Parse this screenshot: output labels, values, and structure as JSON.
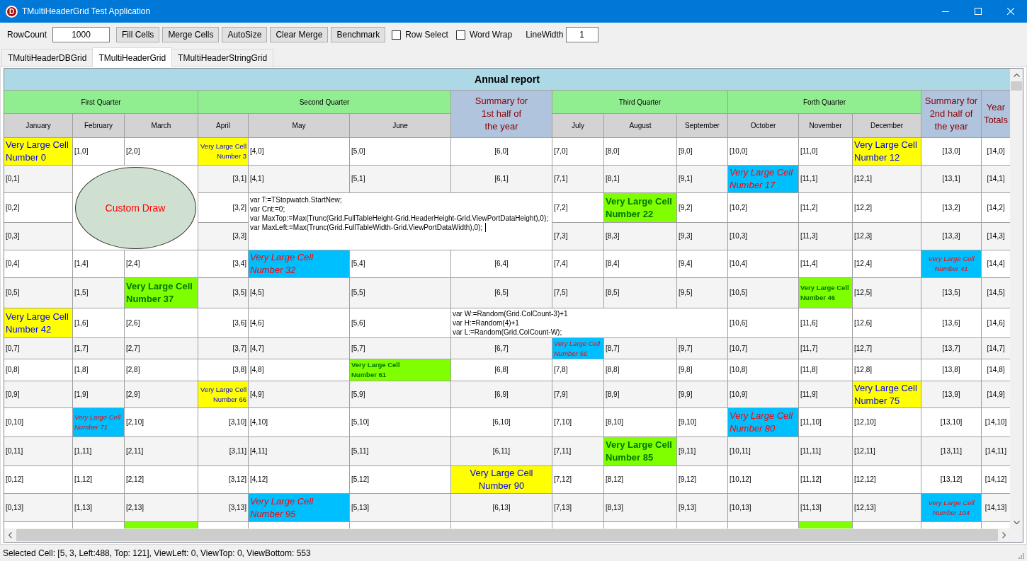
{
  "window": {
    "icon_letter": "D",
    "title": "TMultiHeaderGrid Test Application"
  },
  "toolbar": {
    "row_count": {
      "label": "RowCount",
      "value": "1000"
    },
    "buttons": [
      "Fill Cells",
      "Merge Cells",
      "AutoSize",
      "Clear Merge",
      "Benchmark"
    ],
    "checkboxes": [
      {
        "label": "Row Select",
        "checked": false
      },
      {
        "label": "Word Wrap",
        "checked": false
      }
    ],
    "line_width": {
      "label": "LineWidth",
      "value": "1"
    }
  },
  "tabs": [
    {
      "label": "TMultiHeaderDBGrid",
      "selected": false
    },
    {
      "label": "TMultiHeaderGrid",
      "selected": true
    },
    {
      "label": "TMultiHeaderStringGrid",
      "selected": false
    }
  ],
  "grid": {
    "title": "Annual report",
    "groups": [
      {
        "kind": "quarter",
        "label": "First Quarter",
        "columns": [
          "January",
          "February",
          "March"
        ]
      },
      {
        "kind": "quarter",
        "label": "Second Quarter",
        "columns": [
          "April",
          "May",
          "June"
        ]
      },
      {
        "kind": "summary",
        "label": "Summary for\n1st half of\nthe year"
      },
      {
        "kind": "quarter",
        "label": "Third Quarter",
        "columns": [
          "July",
          "August",
          "September"
        ]
      },
      {
        "kind": "quarter",
        "label": "Forth Quarter",
        "columns": [
          "October",
          "November",
          "December"
        ]
      },
      {
        "kind": "summary",
        "label": "Summary for\n2nd half of\nthe year"
      },
      {
        "kind": "summary",
        "label": "Year\nTotals"
      }
    ],
    "rows": [
      [
        {
          "kind": "yellow",
          "large": true,
          "text": "Very Large Cell\nNumber 0"
        },
        {
          "kind": "plain",
          "text": "[1,0]"
        },
        {
          "kind": "plain",
          "text": "[2,0]"
        },
        {
          "kind": "yellow",
          "large": false,
          "text": "Very Large Cell\nNumber 3"
        },
        {
          "kind": "plain",
          "text": "[4,0]"
        },
        {
          "kind": "plain",
          "text": "[5,0]"
        },
        {
          "kind": "plain",
          "text": "[6,0]"
        },
        {
          "kind": "plain",
          "text": "[7,0]"
        },
        {
          "kind": "plain",
          "text": "[8,0]"
        },
        {
          "kind": "plain",
          "text": "[9,0]"
        },
        {
          "kind": "plain",
          "text": "[10,0]"
        },
        {
          "kind": "plain",
          "text": "[11,0]"
        },
        {
          "kind": "yellow",
          "large": true,
          "text": "Very Large Cell\nNumber 12"
        },
        {
          "kind": "plain",
          "text": "[13,0]"
        },
        {
          "kind": "plain",
          "text": "[14,0]"
        }
      ],
      [
        {
          "kind": "plain",
          "text": "[0,1]"
        },
        {
          "kind": "covered"
        },
        {
          "kind": "covered"
        },
        {
          "kind": "plain",
          "text": "[3,1]"
        },
        {
          "kind": "plain",
          "text": "[4,1]"
        },
        {
          "kind": "plain",
          "text": "[5,1]"
        },
        {
          "kind": "plain",
          "text": "[6,1]"
        },
        {
          "kind": "plain",
          "text": "[7,1]"
        },
        {
          "kind": "plain",
          "text": "[8,1]"
        },
        {
          "kind": "plain",
          "text": "[9,1]"
        },
        {
          "kind": "cyan",
          "large": true,
          "text": "Very Large Cell\nNumber 17"
        },
        {
          "kind": "plain",
          "text": "[11,1]"
        },
        {
          "kind": "plain",
          "text": "[12,1]"
        },
        {
          "kind": "plain",
          "text": "[13,1]"
        },
        {
          "kind": "plain",
          "text": "[14,1]"
        }
      ],
      [
        {
          "kind": "plain",
          "text": "[0,2]"
        },
        {
          "kind": "drawing",
          "text": "Custom Draw"
        },
        {
          "kind": "covered"
        },
        {
          "kind": "plain",
          "text": "[3,2]"
        },
        {
          "kind": "code",
          "editing": true,
          "text": "var T:=TStopwatch.StartNew;\nvar Cnt:=0;\nvar MaxTop:=Max(Trunc(Grid.FullTableHeight-Grid.HeaderHeight-Grid.ViewPortDataHeight),0);\nvar MaxLeft:=Max(Trunc(Grid.FullTableWidth-Grid.ViewPortDataWidth),0);"
        },
        {
          "kind": "covered"
        },
        {
          "kind": "covered"
        },
        {
          "kind": "plain",
          "text": "[7,2]"
        },
        {
          "kind": "green",
          "large": true,
          "text": "Very Large Cell\nNumber 22"
        },
        {
          "kind": "plain",
          "text": "[9,2]"
        },
        {
          "kind": "plain",
          "text": "[10,2]"
        },
        {
          "kind": "plain",
          "text": "[11,2]"
        },
        {
          "kind": "plain",
          "text": "[12,2]"
        },
        {
          "kind": "plain",
          "text": "[13,2]"
        },
        {
          "kind": "plain",
          "text": "[14,2]"
        }
      ],
      [
        {
          "kind": "plain",
          "text": "[0,3]"
        },
        {
          "kind": "covered"
        },
        {
          "kind": "covered"
        },
        {
          "kind": "plain",
          "text": "[3,3]"
        },
        {
          "kind": "covered"
        },
        {
          "kind": "covered"
        },
        {
          "kind": "covered"
        },
        {
          "kind": "plain",
          "text": "[7,3]"
        },
        {
          "kind": "plain",
          "text": "[8,3]"
        },
        {
          "kind": "plain",
          "text": "[9,3]"
        },
        {
          "kind": "plain",
          "text": "[10,3]"
        },
        {
          "kind": "plain",
          "text": "[11,3]"
        },
        {
          "kind": "plain",
          "text": "[12,3]"
        },
        {
          "kind": "plain",
          "text": "[13,3]"
        },
        {
          "kind": "plain",
          "text": "[14,3]"
        }
      ],
      [
        {
          "kind": "plain",
          "text": "[0,4]"
        },
        {
          "kind": "plain",
          "text": "[1,4]"
        },
        {
          "kind": "plain",
          "text": "[2,4]"
        },
        {
          "kind": "plain",
          "text": "[3,4]"
        },
        {
          "kind": "cyan",
          "large": true,
          "text": "Very Large Cell\nNumber 32"
        },
        {
          "kind": "plain",
          "text": "[5,4]"
        },
        {
          "kind": "plain",
          "text": "[6,4]"
        },
        {
          "kind": "plain",
          "text": "[7,4]"
        },
        {
          "kind": "plain",
          "text": "[8,4]"
        },
        {
          "kind": "plain",
          "text": "[9,4]"
        },
        {
          "kind": "plain",
          "text": "[10,4]"
        },
        {
          "kind": "plain",
          "text": "[11,4]"
        },
        {
          "kind": "plain",
          "text": "[12,4]"
        },
        {
          "kind": "cyan",
          "large": false,
          "text": "Very Large Cell\nNumber 41"
        },
        {
          "kind": "plain",
          "text": "[14,4]"
        }
      ],
      [
        {
          "kind": "plain",
          "text": "[0,5]"
        },
        {
          "kind": "plain",
          "text": "[1,5]"
        },
        {
          "kind": "green",
          "large": true,
          "text": "Very Large Cell\nNumber 37"
        },
        {
          "kind": "plain",
          "text": "[3,5]"
        },
        {
          "kind": "plain",
          "text": "[4,5]"
        },
        {
          "kind": "plain",
          "text": "[5,5]"
        },
        {
          "kind": "plain",
          "text": "[6,5]"
        },
        {
          "kind": "plain",
          "text": "[7,5]"
        },
        {
          "kind": "plain",
          "text": "[8,5]"
        },
        {
          "kind": "plain",
          "text": "[9,5]"
        },
        {
          "kind": "plain",
          "text": "[10,5]"
        },
        {
          "kind": "green",
          "large": false,
          "text": "Very Large Cell\nNumber 46"
        },
        {
          "kind": "plain",
          "text": "[12,5]"
        },
        {
          "kind": "plain",
          "text": "[13,5]"
        },
        {
          "kind": "plain",
          "text": "[14,5]"
        }
      ],
      [
        {
          "kind": "yellow",
          "large": true,
          "text": "Very Large Cell\nNumber 42"
        },
        {
          "kind": "plain",
          "text": "[1,6]"
        },
        {
          "kind": "plain",
          "text": "[2,6]"
        },
        {
          "kind": "plain",
          "text": "[3,6]"
        },
        {
          "kind": "plain",
          "text": "[4,6]"
        },
        {
          "kind": "plain",
          "text": "[5,6]"
        },
        {
          "kind": "code",
          "editing": false,
          "text": "var W:=Random(Grid.ColCount-3)+1\nvar H:=Random(4)+1\nvar L:=Random(Grid.ColCount-W);"
        },
        {
          "kind": "covered"
        },
        {
          "kind": "covered"
        },
        {
          "kind": "covered"
        },
        {
          "kind": "plain",
          "text": "[10,6]"
        },
        {
          "kind": "plain",
          "text": "[11,6]"
        },
        {
          "kind": "plain",
          "text": "[12,6]"
        },
        {
          "kind": "plain",
          "text": "[13,6]"
        },
        {
          "kind": "plain",
          "text": "[14,6]"
        }
      ],
      [
        {
          "kind": "plain",
          "text": "[0,7]"
        },
        {
          "kind": "plain",
          "text": "[1,7]"
        },
        {
          "kind": "plain",
          "text": "[2,7]"
        },
        {
          "kind": "plain",
          "text": "[3,7]"
        },
        {
          "kind": "plain",
          "text": "[4,7]"
        },
        {
          "kind": "plain",
          "text": "[5,7]"
        },
        {
          "kind": "plain",
          "text": "[6,7]"
        },
        {
          "kind": "cyan",
          "large": false,
          "text": "Very Large Cell\nNumber 56"
        },
        {
          "kind": "plain",
          "text": "[8,7]"
        },
        {
          "kind": "plain",
          "text": "[9,7]"
        },
        {
          "kind": "plain",
          "text": "[10,7]"
        },
        {
          "kind": "plain",
          "text": "[11,7]"
        },
        {
          "kind": "plain",
          "text": "[12,7]"
        },
        {
          "kind": "plain",
          "text": "[13,7]"
        },
        {
          "kind": "plain",
          "text": "[14,7]"
        }
      ],
      [
        {
          "kind": "plain",
          "text": "[0,8]"
        },
        {
          "kind": "plain",
          "text": "[1,8]"
        },
        {
          "kind": "plain",
          "text": "[2,8]"
        },
        {
          "kind": "plain",
          "text": "[3,8]"
        },
        {
          "kind": "plain",
          "text": "[4,8]"
        },
        {
          "kind": "green",
          "large": false,
          "text": "Very Large Cell\nNumber 61"
        },
        {
          "kind": "plain",
          "text": "[6,8]"
        },
        {
          "kind": "plain",
          "text": "[7,8]"
        },
        {
          "kind": "plain",
          "text": "[8,8]"
        },
        {
          "kind": "plain",
          "text": "[9,8]"
        },
        {
          "kind": "plain",
          "text": "[10,8]"
        },
        {
          "kind": "plain",
          "text": "[11,8]"
        },
        {
          "kind": "plain",
          "text": "[12,8]"
        },
        {
          "kind": "plain",
          "text": "[13,8]"
        },
        {
          "kind": "plain",
          "text": "[14,8]"
        }
      ],
      [
        {
          "kind": "plain",
          "text": "[0,9]"
        },
        {
          "kind": "plain",
          "text": "[1,9]"
        },
        {
          "kind": "plain",
          "text": "[2,9]"
        },
        {
          "kind": "yellow",
          "large": false,
          "text": "Very Large Cell\nNumber 66"
        },
        {
          "kind": "plain",
          "text": "[4,9]"
        },
        {
          "kind": "plain",
          "text": "[5,9]"
        },
        {
          "kind": "plain",
          "text": "[6,9]"
        },
        {
          "kind": "plain",
          "text": "[7,9]"
        },
        {
          "kind": "plain",
          "text": "[8,9]"
        },
        {
          "kind": "plain",
          "text": "[9,9]"
        },
        {
          "kind": "plain",
          "text": "[10,9]"
        },
        {
          "kind": "plain",
          "text": "[11,9]"
        },
        {
          "kind": "yellow",
          "large": true,
          "text": "Very Large Cell\nNumber 75"
        },
        {
          "kind": "plain",
          "text": "[13,9]"
        },
        {
          "kind": "plain",
          "text": "[14,9]"
        }
      ],
      [
        {
          "kind": "plain",
          "text": "[0,10]"
        },
        {
          "kind": "cyan",
          "large": false,
          "text": "Very Large Cell\nNumber 71"
        },
        {
          "kind": "plain",
          "text": "[2,10]"
        },
        {
          "kind": "plain",
          "text": "[3,10]"
        },
        {
          "kind": "plain",
          "text": "[4,10]"
        },
        {
          "kind": "plain",
          "text": "[5,10]"
        },
        {
          "kind": "plain",
          "text": "[6,10]"
        },
        {
          "kind": "plain",
          "text": "[7,10]"
        },
        {
          "kind": "plain",
          "text": "[8,10]"
        },
        {
          "kind": "plain",
          "text": "[9,10]"
        },
        {
          "kind": "cyan",
          "large": true,
          "text": "Very Large Cell\nNumber 80"
        },
        {
          "kind": "plain",
          "text": "[11,10]"
        },
        {
          "kind": "plain",
          "text": "[12,10]"
        },
        {
          "kind": "plain",
          "text": "[13,10]"
        },
        {
          "kind": "plain",
          "text": "[14,10]"
        }
      ],
      [
        {
          "kind": "plain",
          "text": "[0,11]"
        },
        {
          "kind": "plain",
          "text": "[1,11]"
        },
        {
          "kind": "plain",
          "text": "[2,11]"
        },
        {
          "kind": "plain",
          "text": "[3,11]"
        },
        {
          "kind": "plain",
          "text": "[4,11]"
        },
        {
          "kind": "plain",
          "text": "[5,11]"
        },
        {
          "kind": "plain",
          "text": "[6,11]"
        },
        {
          "kind": "plain",
          "text": "[7,11]"
        },
        {
          "kind": "green",
          "large": true,
          "text": "Very Large Cell\nNumber 85"
        },
        {
          "kind": "plain",
          "text": "[9,11]"
        },
        {
          "kind": "plain",
          "text": "[10,11]"
        },
        {
          "kind": "plain",
          "text": "[11,11]"
        },
        {
          "kind": "plain",
          "text": "[12,11]"
        },
        {
          "kind": "plain",
          "text": "[13,11]"
        },
        {
          "kind": "plain",
          "text": "[14,11]"
        }
      ],
      [
        {
          "kind": "plain",
          "text": "[0,12]"
        },
        {
          "kind": "plain",
          "text": "[1,12]"
        },
        {
          "kind": "plain",
          "text": "[2,12]"
        },
        {
          "kind": "plain",
          "text": "[3,12]"
        },
        {
          "kind": "plain",
          "text": "[4,12]"
        },
        {
          "kind": "plain",
          "text": "[5,12]"
        },
        {
          "kind": "yellow",
          "large": true,
          "text": "Very Large Cell\nNumber 90"
        },
        {
          "kind": "plain",
          "text": "[7,12]"
        },
        {
          "kind": "plain",
          "text": "[8,12]"
        },
        {
          "kind": "plain",
          "text": "[9,12]"
        },
        {
          "kind": "plain",
          "text": "[10,12]"
        },
        {
          "kind": "plain",
          "text": "[11,12]"
        },
        {
          "kind": "plain",
          "text": "[12,12]"
        },
        {
          "kind": "plain",
          "text": "[13,12]"
        },
        {
          "kind": "plain",
          "text": "[14,12]"
        }
      ],
      [
        {
          "kind": "plain",
          "text": "[0,13]"
        },
        {
          "kind": "plain",
          "text": "[1,13]"
        },
        {
          "kind": "plain",
          "text": "[2,13]"
        },
        {
          "kind": "plain",
          "text": "[3,13]"
        },
        {
          "kind": "cyan",
          "large": true,
          "text": "Very Large Cell\nNumber 95"
        },
        {
          "kind": "plain",
          "text": "[5,13]"
        },
        {
          "kind": "plain",
          "text": "[6,13]"
        },
        {
          "kind": "plain",
          "text": "[7,13]"
        },
        {
          "kind": "plain",
          "text": "[8,13]"
        },
        {
          "kind": "plain",
          "text": "[9,13]"
        },
        {
          "kind": "plain",
          "text": "[10,13]"
        },
        {
          "kind": "plain",
          "text": "[11,13]"
        },
        {
          "kind": "plain",
          "text": "[12,13]"
        },
        {
          "kind": "cyan",
          "large": false,
          "text": "Very Large Cell\nNumber 104"
        },
        {
          "kind": "plain",
          "text": "[14,13]"
        }
      ],
      [
        {
          "kind": "plain"
        },
        {
          "kind": "plain"
        },
        {
          "kind": "green"
        },
        {
          "kind": "plain"
        },
        {
          "kind": "plain"
        },
        {
          "kind": "plain"
        },
        {
          "kind": "plain"
        },
        {
          "kind": "plain"
        },
        {
          "kind": "plain"
        },
        {
          "kind": "plain"
        },
        {
          "kind": "plain"
        },
        {
          "kind": "green"
        },
        {
          "kind": "plain"
        },
        {
          "kind": "plain"
        },
        {
          "kind": "plain"
        }
      ]
    ]
  },
  "status_bar": "Selected Cell: [5, 3, Left:488, Top: 121], ViewLeft: 0, ViewTop: 0, ViewBottom: 553"
}
